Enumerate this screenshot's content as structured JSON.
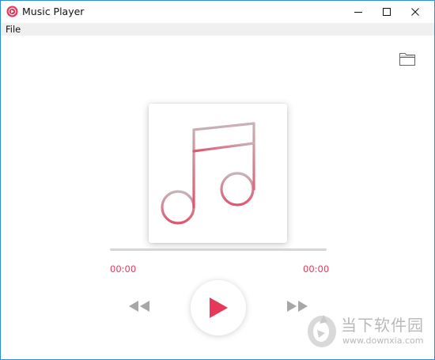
{
  "window": {
    "title": "Music Player",
    "accent_color": "#e8375a",
    "border_color": "#2a8fd6",
    "controls": [
      "minimize-icon",
      "maximize-icon",
      "close-icon"
    ]
  },
  "menu": {
    "items": [
      {
        "label": "File"
      }
    ]
  },
  "toolbar": {
    "open_folder_icon": "folder-open-icon"
  },
  "album": {
    "art_icon": "music-note-icon"
  },
  "playback": {
    "progress": 0,
    "current_time": "00:00",
    "total_time": "00:00",
    "is_playing": false,
    "prev_icon": "rewind-icon",
    "play_icon": "play-icon",
    "next_icon": "fast-forward-icon"
  },
  "watermark": {
    "brand_cn": "当下软件园",
    "url": "www.downxia.com"
  }
}
